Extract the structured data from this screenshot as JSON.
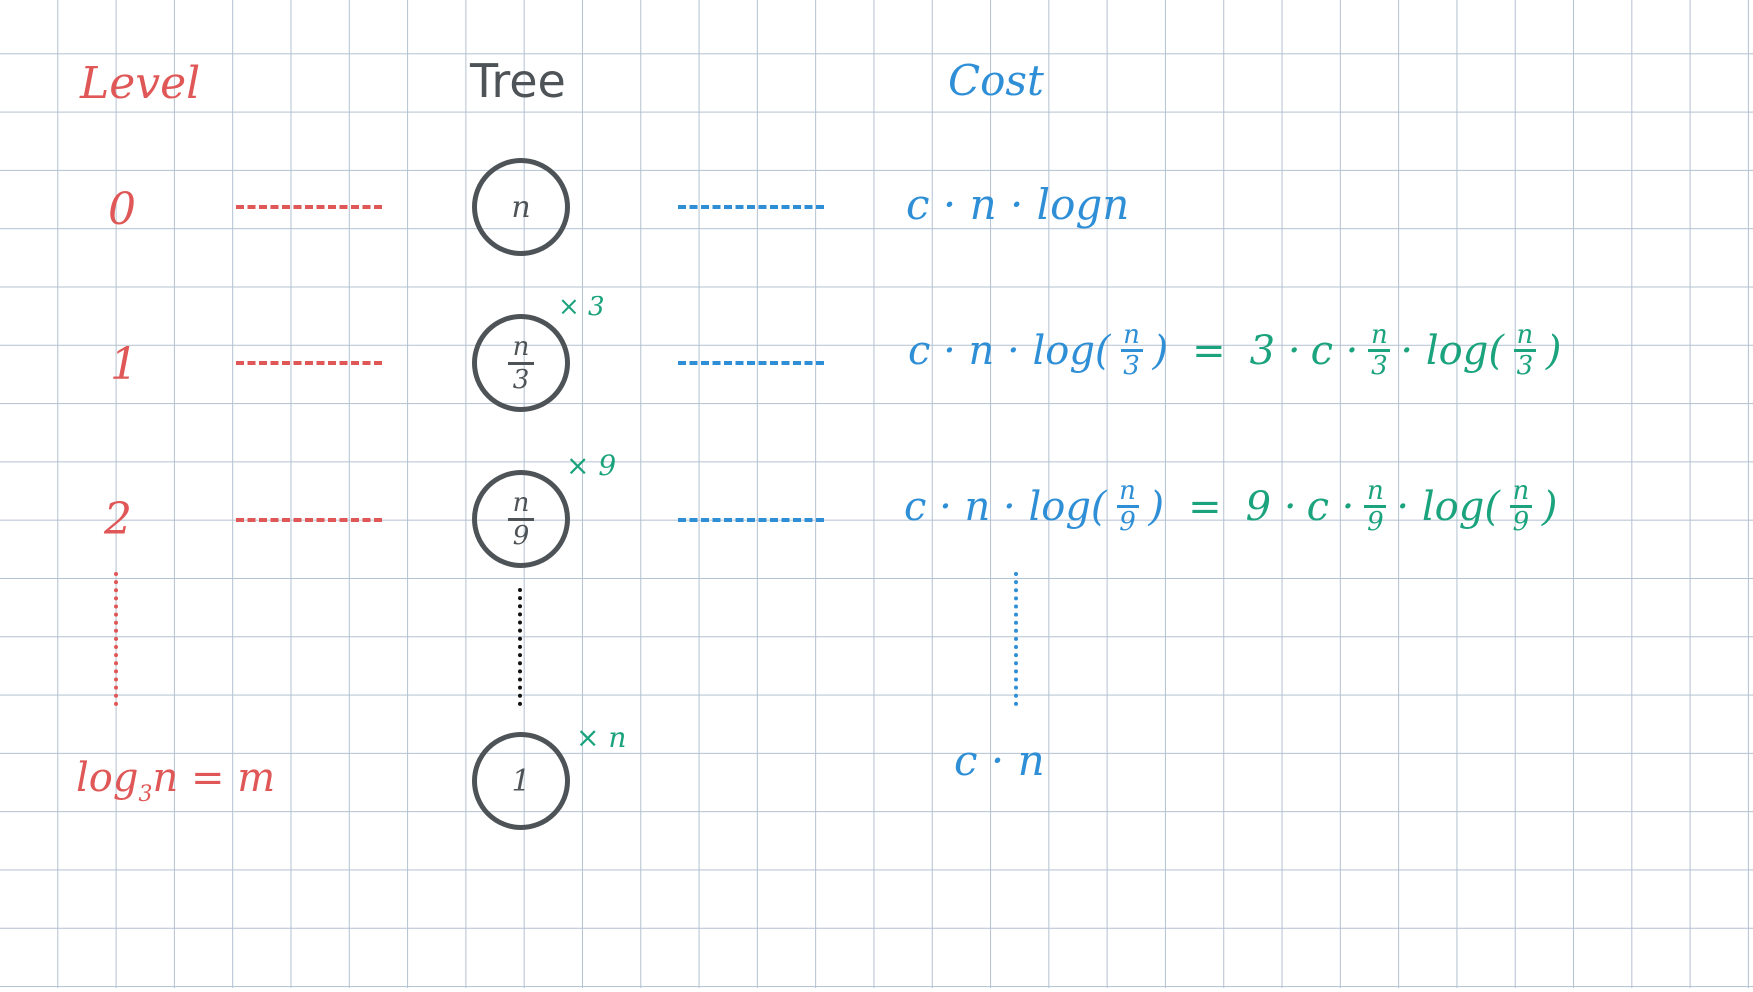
{
  "headers": {
    "level": "Level",
    "tree": "Tree",
    "cost": "Cost"
  },
  "levels": {
    "l0": "0",
    "l1": "1",
    "l2": "2",
    "last_log": "log",
    "last_base": "3",
    "last_rest": "n = m"
  },
  "tree": {
    "node0": "n",
    "node1_num": "n",
    "node1_den": "3",
    "node2_num": "n",
    "node2_den": "9",
    "node_last": "1",
    "mult1": "× 3",
    "mult2": "× 9",
    "mult_last": "× n"
  },
  "costs": {
    "c0": "c · n · logn",
    "c1_left": "c · n · log(",
    "c1_num": "n",
    "c1_den": "3",
    "c1_close": ")",
    "c1_eq": "=",
    "c1_factor": "3 ·",
    "c1_c": "c ·",
    "c1_n": "n",
    "c1_d": "3",
    "c1_log": "· log(",
    "c1_ln": "n",
    "c1_ld": "3",
    "c1_lclose": ")",
    "c2_left": "c · n · log(",
    "c2_num": "n",
    "c2_den": "9",
    "c2_close": ")",
    "c2_eq": "=",
    "c2_factor": "9 ·",
    "c2_c": "c ·",
    "c2_n": "n",
    "c2_d": "9",
    "c2_log": "· log(",
    "c2_ln": "n",
    "c2_ld": "9",
    "c2_lclose": ")",
    "c_last": "c · n"
  },
  "colors": {
    "red": "#e05757",
    "blue": "#2f8fd6",
    "green": "#1aa37d",
    "dark": "#4d5356",
    "grid": "#b3c1d1"
  }
}
